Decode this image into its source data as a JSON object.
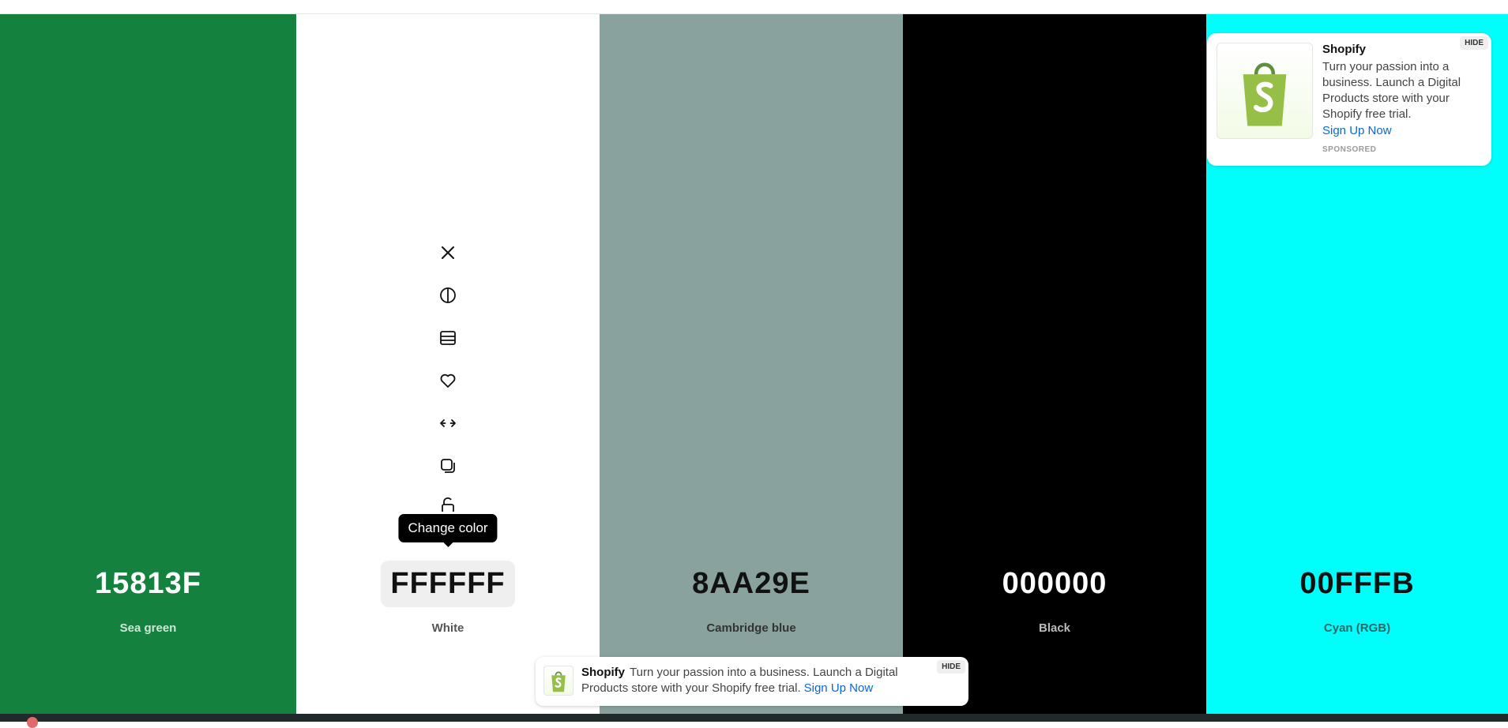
{
  "palette": {
    "swatches": [
      {
        "hex": "15813F",
        "name": "Sea green",
        "bg": "#15813F",
        "fg": "#ffffff",
        "sub": "#cfe6d6"
      },
      {
        "hex": "FFFFFF",
        "name": "White",
        "bg": "#FFFFFF",
        "fg": "#111111",
        "sub": "#555555"
      },
      {
        "hex": "8AA29E",
        "name": "Cambridge blue",
        "bg": "#8AA29E",
        "fg": "#111111",
        "sub": "#333333"
      },
      {
        "hex": "000000",
        "name": "Black",
        "bg": "#000000",
        "fg": "#ffffff",
        "sub": "#bbbbbb"
      },
      {
        "hex": "00FFFB",
        "name": "Cyan (RGB)",
        "bg": "#00FFFB",
        "fg": "#111111",
        "sub": "#336666"
      }
    ],
    "active_index": 1
  },
  "toolbar": {
    "icons": [
      "close-icon",
      "contrast-icon",
      "shades-icon",
      "heart-icon",
      "drag-icon",
      "copy-icon",
      "unlock-icon"
    ],
    "tooltip": "Change color"
  },
  "ad_card": {
    "brand": "Shopify",
    "text": "Turn your passion into a business. Launch a Digital Products store with your Shopify free trial.",
    "cta": "Sign Up Now",
    "sponsored": "SPONSORED",
    "hide": "HIDE"
  },
  "ad_banner": {
    "brand": "Shopify",
    "text": "Turn your passion into a business. Launch a Digital Products store with your Shopify free trial.",
    "cta": "Sign Up Now",
    "hide": "HIDE"
  },
  "colors": {
    "link": "#0a66d8",
    "shopify_green": "#95bf47"
  }
}
